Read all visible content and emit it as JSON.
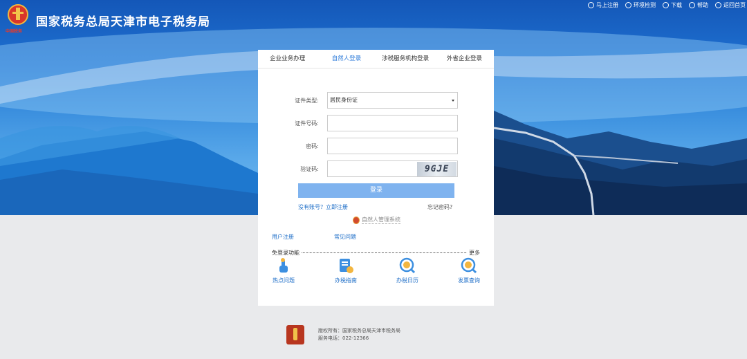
{
  "site": {
    "title": "国家税务总局天津市电子税务局",
    "emblem_text": "中国税务"
  },
  "top_links": [
    {
      "label": "马上注册",
      "icon": "user-icon"
    },
    {
      "label": "环境检测",
      "icon": "tool-icon"
    },
    {
      "label": "下载",
      "icon": "download-icon"
    },
    {
      "label": "帮助",
      "icon": "help-icon"
    },
    {
      "label": "返回首页",
      "icon": "back-icon"
    }
  ],
  "tabs": [
    {
      "label": "企业业务办理"
    },
    {
      "label": "自然人登录"
    },
    {
      "label": "涉税服务机构登录"
    },
    {
      "label": "外省企业登录"
    }
  ],
  "form": {
    "id_type_label": "证件类型:",
    "id_type_value": "居民身份证",
    "id_number_label": "证件号码:",
    "password_label": "密码:",
    "captcha_label": "验证码:",
    "captcha_text": "9GJE",
    "login_button": "登录",
    "register_link": "没有账号？立即注册",
    "forgot_link": "忘记密码?",
    "system_link": "自然人管理系统"
  },
  "links": {
    "user_register": "用户注册",
    "faq": "常见问题"
  },
  "quick_section": {
    "title": "免登录功能",
    "more": "更多",
    "items": [
      {
        "label": "热点问题",
        "icon": "hand-pointer-icon"
      },
      {
        "label": "办税指南",
        "icon": "guide-icon"
      },
      {
        "label": "办税日历",
        "icon": "calendar-icon"
      },
      {
        "label": "发票查询",
        "icon": "invoice-search-icon"
      }
    ]
  },
  "footer": {
    "line1": "版权所有：国家税务总局天津市税务局",
    "line2": "服务电话：022-12366"
  },
  "colors": {
    "accent": "#2b7ad9",
    "link": "#1f6fc8",
    "button": "#7fb3ef",
    "banner_top": "#1457b8"
  }
}
